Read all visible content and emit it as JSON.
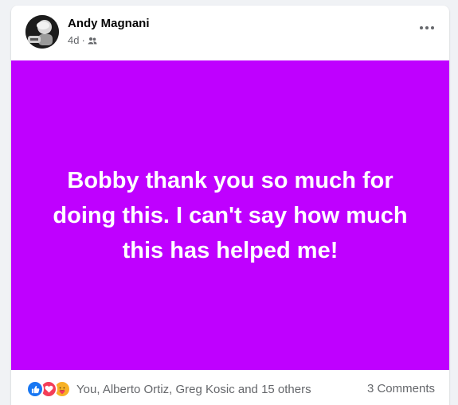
{
  "post": {
    "author": "Andy Magnani",
    "time": "4d",
    "meta_separator": "·",
    "audience_icon": "friends-icon",
    "text": "Bobby thank you so much for doing this. I can't say how much this has helped me!",
    "background_color": "#bf00ff",
    "text_color": "#ffffff"
  },
  "footer": {
    "reaction_icons": [
      "like-icon",
      "love-icon",
      "care-icon"
    ],
    "reactors": "You, Alberto Ortiz, Greg Kosic and 15 others",
    "comments": "3 Comments"
  },
  "colors": {
    "like": "#1877f2",
    "love": "#f33e58",
    "care": "#f7b125",
    "muted_text": "#65676b"
  }
}
